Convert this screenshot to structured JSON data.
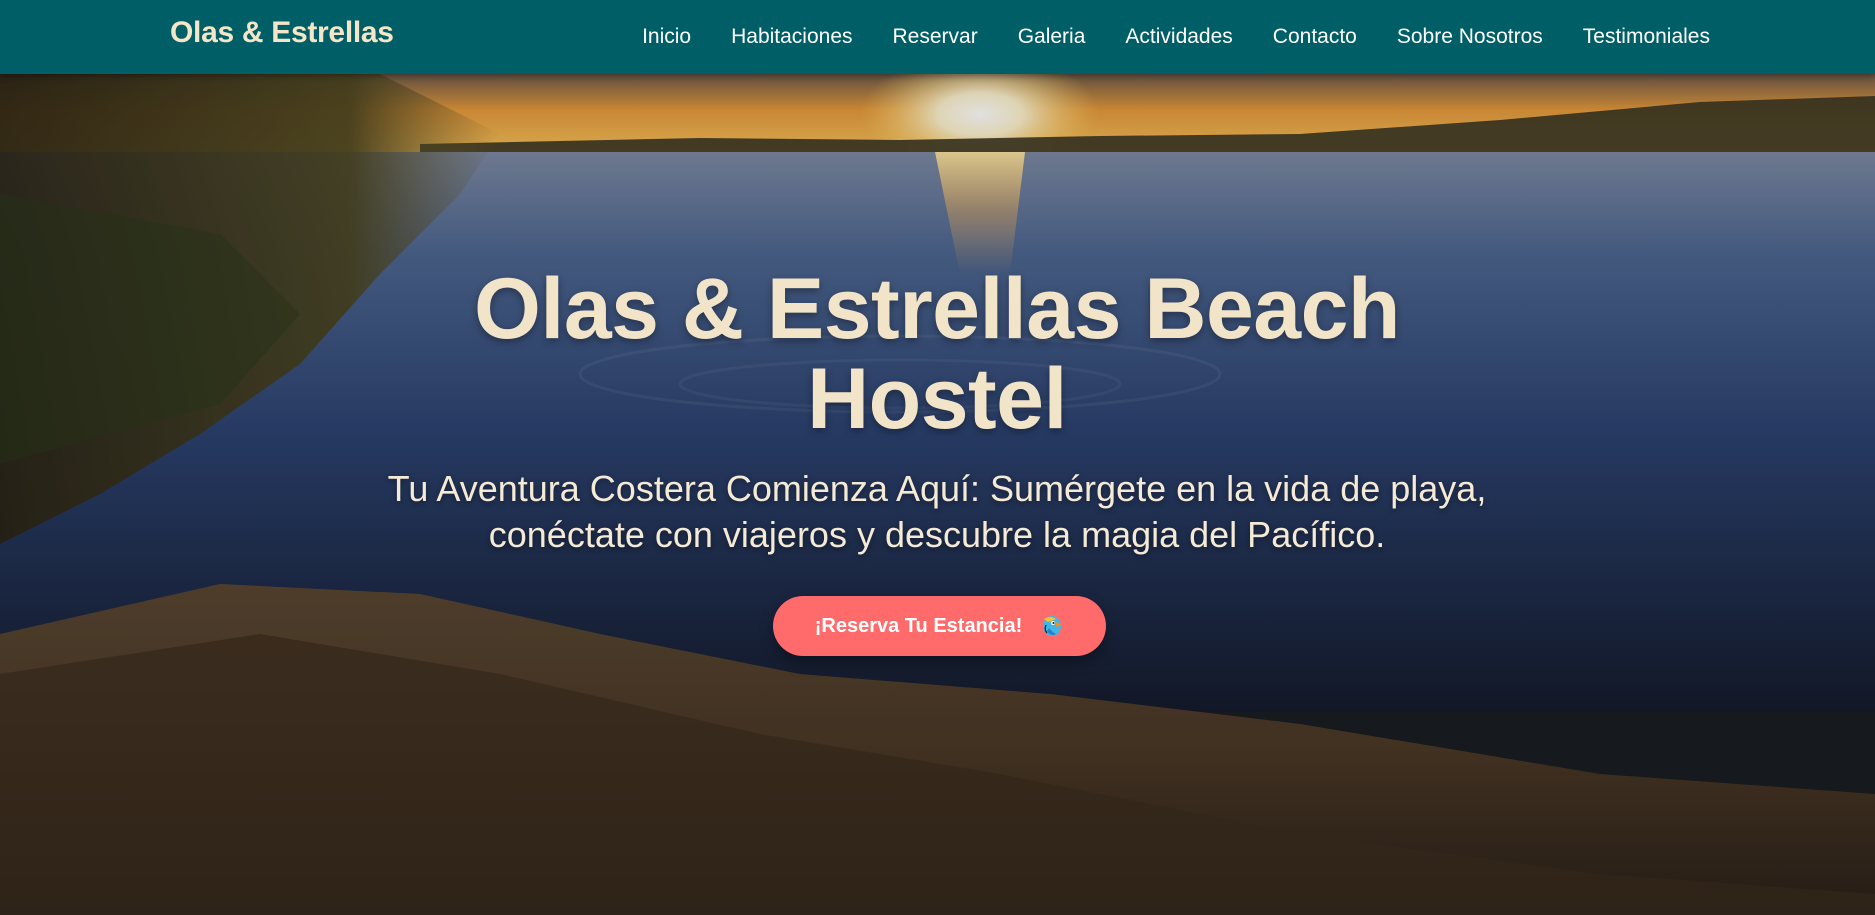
{
  "navbar": {
    "brand": "Olas & Estrellas",
    "links": [
      {
        "label": "Inicio"
      },
      {
        "label": "Habitaciones"
      },
      {
        "label": "Reservar"
      },
      {
        "label": "Galeria"
      },
      {
        "label": "Actividades"
      },
      {
        "label": "Contacto"
      },
      {
        "label": "Sobre Nosotros"
      },
      {
        "label": "Testimoniales"
      }
    ]
  },
  "hero": {
    "title": "Olas & Estrellas Beach Hostel",
    "subtitle": "Tu Aventura Costera Comienza Aquí: Sumérgete en la vida de playa, conéctate con viajeros y descubre la magia del Pacífico.",
    "cta": {
      "label": "¡Reserva Tu Estancia!",
      "icon": "parrot-icon"
    }
  },
  "colors": {
    "navbar_bg": "#005f66",
    "brand_text": "#f4e6c8",
    "cta_bg": "#ff6b6b",
    "hero_text": "#f2e4c9"
  }
}
